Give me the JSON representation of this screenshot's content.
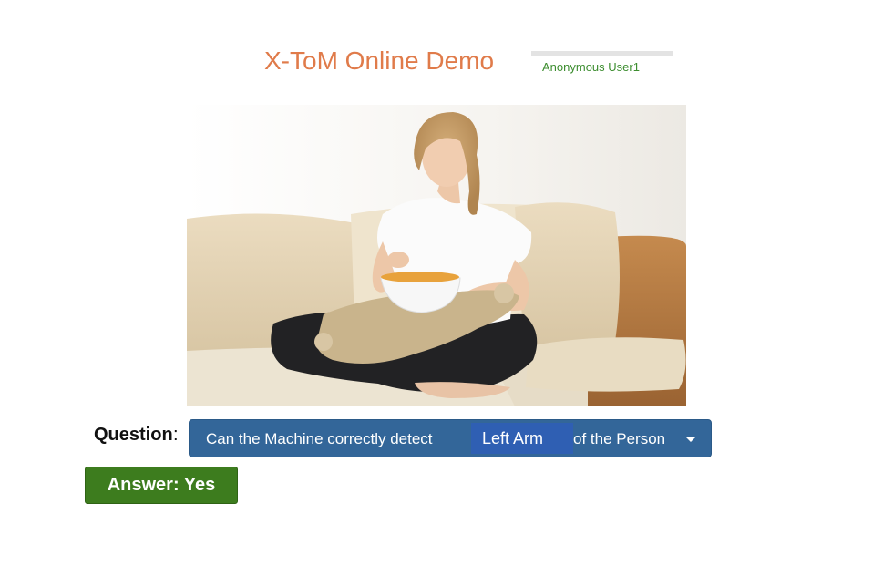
{
  "header": {
    "title": "X-ToM Online Demo",
    "user": "Anonymous User1"
  },
  "image": {
    "subject": "woman-eating-snack-on-sofa"
  },
  "question": {
    "label": "Question",
    "colon": ":",
    "prefix": "Can the Machine correctly detect",
    "part": "Left Arm",
    "suffix": "of the Person"
  },
  "answer": {
    "label": "Answer: Yes"
  },
  "colors": {
    "title": "#e07b4a",
    "user": "#3c8d2f",
    "question_button": "#336699",
    "part_highlight": "#2f5fb3",
    "answer_button": "#3d7c1e"
  }
}
